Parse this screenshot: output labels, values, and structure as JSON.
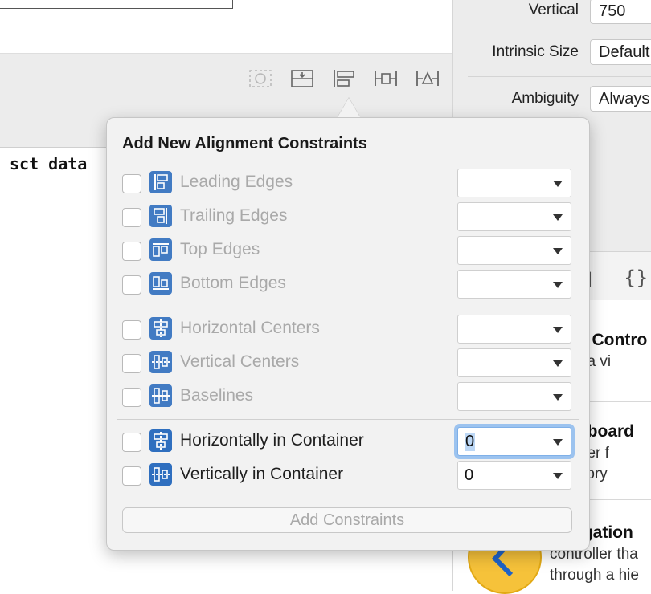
{
  "editor": {
    "code_fragment": "sct data"
  },
  "inspector": {
    "rows": [
      {
        "label": "Vertical",
        "value": "750"
      },
      {
        "label": "Intrinsic Size",
        "value": "Default"
      },
      {
        "label": "Ambiguity",
        "value": "Always"
      }
    ],
    "library_items": [
      {
        "title": "View Controller",
        "description": "manages a view"
      },
      {
        "title": "Storyboard",
        "description": "placeholder for external storyboard"
      },
      {
        "title": "Navigation",
        "description": "controller that manages navigation through a hierarchy"
      }
    ],
    "lib_text": {
      "item1_title": "v Contro",
      "item1_desc": "ages a vi",
      "item2_title": "yboard",
      "item2_desc1": "eholder f",
      "item2_desc2": "nal story",
      "item3_title": "igation",
      "item3_desc1": "controller tha",
      "item3_desc2": "through a hie"
    },
    "accent_color": "#f6c23a"
  },
  "popover": {
    "title": "Add New Alignment Constraints",
    "rows": [
      {
        "label": "Leading Edges",
        "enabled": false,
        "value": "",
        "icon": "leading-edges-icon"
      },
      {
        "label": "Trailing Edges",
        "enabled": false,
        "value": "",
        "icon": "trailing-edges-icon"
      },
      {
        "label": "Top Edges",
        "enabled": false,
        "value": "",
        "icon": "top-edges-icon"
      },
      {
        "label": "Bottom Edges",
        "enabled": false,
        "value": "",
        "icon": "bottom-edges-icon"
      },
      {
        "label": "Horizontal Centers",
        "enabled": false,
        "value": "",
        "icon": "horizontal-centers-icon"
      },
      {
        "label": "Vertical Centers",
        "enabled": false,
        "value": "",
        "icon": "vertical-centers-icon"
      },
      {
        "label": "Baselines",
        "enabled": false,
        "value": "",
        "icon": "baselines-icon"
      },
      {
        "label": "Horizontally in Container",
        "enabled": true,
        "value": "0",
        "icon": "horizontally-in-container-icon"
      },
      {
        "label": "Vertically in Container",
        "enabled": true,
        "value": "0",
        "icon": "vertically-in-container-icon"
      }
    ],
    "add_button": "Add Constraints",
    "icon_color": "#2f6fbf"
  }
}
